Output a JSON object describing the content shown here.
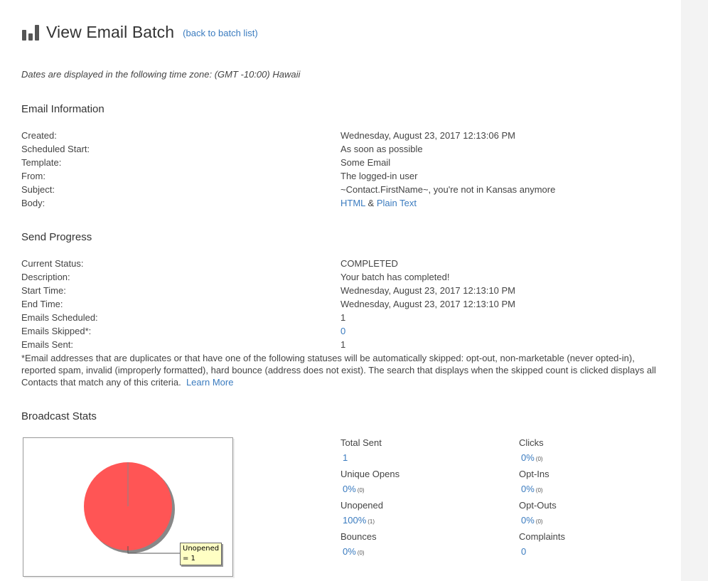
{
  "header": {
    "title": "View Email Batch",
    "back_link": "(back to batch list)"
  },
  "timezone_note": "Dates are displayed in the following time zone:  (GMT -10:00) Hawaii",
  "email_information": {
    "title": "Email Information",
    "rows": [
      {
        "label": "Created:",
        "value": "Wednesday, August 23, 2017 12:13:06 PM"
      },
      {
        "label": "Scheduled Start:",
        "value": "As soon as possible"
      },
      {
        "label": "Template:",
        "value": "Some Email"
      },
      {
        "label": "From:",
        "value": "The logged-in user"
      },
      {
        "label": "Subject:",
        "value": "~Contact.FirstName~, you're not in Kansas anymore"
      }
    ],
    "body": {
      "label": "Body:",
      "html_link": "HTML",
      "separator": " & ",
      "text_link": "Plain Text"
    }
  },
  "send_progress": {
    "title": "Send Progress",
    "rows": [
      {
        "label": "Current Status:",
        "value": "COMPLETED"
      },
      {
        "label": "Description:",
        "value": "Your batch has completed!"
      },
      {
        "label": "Start Time:",
        "value": "Wednesday, August 23, 2017 12:13:10 PM"
      },
      {
        "label": "End Time:",
        "value": "Wednesday, August 23, 2017 12:13:10 PM"
      },
      {
        "label": "Emails Scheduled:",
        "value": "1"
      },
      {
        "label": "Emails Skipped*:",
        "value": "0"
      },
      {
        "label": "Emails Sent:",
        "value": "1"
      }
    ],
    "footnote": "*Email addresses that are duplicates or that have one of the following statuses will be automatically skipped: opt-out, non-marketable (never opted-in), reported spam, invalid (improperly formatted), hard bounce (address does not exist). The search that displays when the skipped count is clicked displays all Contacts that match any of this criteria.",
    "learn_more": "Learn More"
  },
  "broadcast_stats": {
    "title": "Broadcast Stats",
    "left_column": [
      {
        "label": "Total Sent",
        "value": "1",
        "count": ""
      },
      {
        "label": "Unique Opens",
        "value": "0%",
        "count": "(0)"
      },
      {
        "label": "Unopened",
        "value": "100%",
        "count": "(1)"
      },
      {
        "label": "Bounces",
        "value": "0%",
        "count": "(0)"
      }
    ],
    "right_column": [
      {
        "label": "Clicks",
        "value": "0%",
        "count": "(0)"
      },
      {
        "label": "Opt-Ins",
        "value": "0%",
        "count": "(0)"
      },
      {
        "label": "Opt-Outs",
        "value": "0%",
        "count": "(0)"
      },
      {
        "label": "Complaints",
        "value": "0",
        "count": ""
      }
    ]
  },
  "chart_data": {
    "type": "pie",
    "title": "",
    "slices": [
      {
        "label": "Unopened",
        "value": 1,
        "color": "#ff5555"
      }
    ],
    "tooltip": "Unopened\n= 1",
    "shadow_color": "#888888"
  },
  "colors": {
    "link": "#3a7bbf",
    "text": "#444444",
    "pie_fill": "#ff5555",
    "tooltip_bg": "#ffffc4",
    "side_strip": "#f3f3f3"
  }
}
